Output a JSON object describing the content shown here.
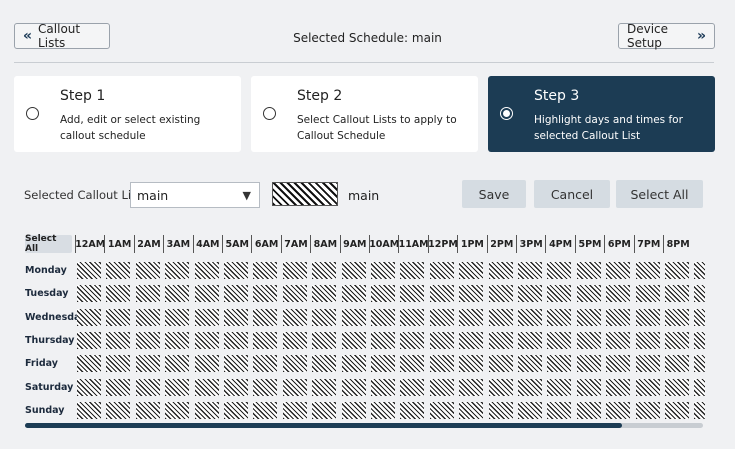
{
  "nav": {
    "back_label": "Callout Lists",
    "back_icon": "double-chevron-left",
    "title": "Selected Schedule: main",
    "next_label": "Device Setup",
    "next_icon": "double-chevron-right"
  },
  "steps": [
    {
      "title": "Step 1",
      "desc": "Add, edit or select existing callout schedule",
      "selected": false
    },
    {
      "title": "Step 2",
      "desc": "Select Callout Lists to apply to Callout Schedule",
      "selected": false
    },
    {
      "title": "Step 3",
      "desc": "Highlight days and times for selected Callout List",
      "selected": true
    }
  ],
  "controls": {
    "label": "Selected Callout Lists",
    "select_value": "main",
    "swatch_label": "main",
    "save": "Save",
    "cancel": "Cancel",
    "select_all": "Select All"
  },
  "grid": {
    "select_all": "Select All",
    "hours": [
      "12AM",
      "1AM",
      "2AM",
      "3AM",
      "4AM",
      "5AM",
      "6AM",
      "7AM",
      "8AM",
      "9AM",
      "10AM",
      "11AM",
      "12PM",
      "1PM",
      "2PM",
      "3PM",
      "4PM",
      "5PM",
      "6PM",
      "7PM",
      "8PM"
    ],
    "days": [
      "Monday",
      "Tuesday",
      "Wednesday",
      "Thursday",
      "Friday",
      "Saturday",
      "Sunday"
    ]
  },
  "colors": {
    "accent": "#1c3c54",
    "background": "#f0f1f3",
    "button_gray": "#d5dce2"
  },
  "scroll": {
    "position_fraction": 0.88
  }
}
